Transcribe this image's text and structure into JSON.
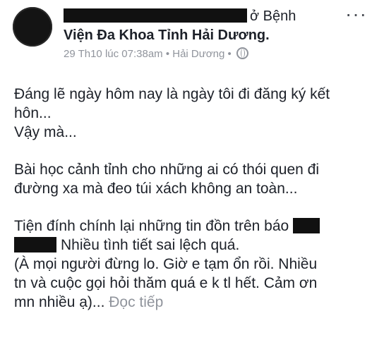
{
  "post": {
    "location_prefix": "ở Bệnh",
    "location": "Viện Đa Khoa Tỉnh Hải Dương",
    "location_period": ".",
    "meta": "29 Th10 lúc 07:38am • Hải Dương •",
    "more_label": "···",
    "paragraphs": {
      "p1_line1": "Đáng lẽ ngày hôm nay là ngày tôi đi đăng ký kết",
      "p1_line2": "hôn...",
      "p1_line3": "Vậy mà...",
      "p2_line1": "Bài học cảnh tỉnh cho những ai có thói quen đi",
      "p2_line2": "đường xa mà đeo túi xách không an toàn...",
      "p3_line1": "Tiện đính chính lại những tin đồn trên báo",
      "p3_line2": "Nhiều tình tiết sai lệch quá.",
      "p3_line3": "(À mọi người đừng lo. Giờ e tạm ổn rồi. Nhiều",
      "p3_line4": "tn và cuộc gọi hỏi thăm quá e k tl hết. Cảm ơn",
      "p3_line5": "mn nhiều ạ)...",
      "read_more": "Đọc tiếp"
    }
  }
}
